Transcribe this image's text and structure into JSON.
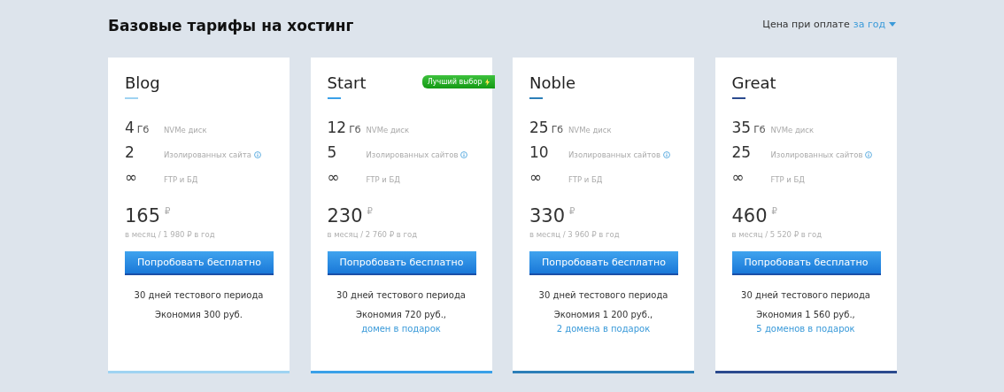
{
  "header": {
    "title": "Базовые тарифы на хостинг",
    "price_label": "Цена при оплате",
    "period_link": "за год"
  },
  "plans": [
    {
      "name": "Blog",
      "color": "#9fd3f2",
      "features": [
        {
          "value": "4",
          "unit": "Гб",
          "label": "NVMe диск",
          "info": false
        },
        {
          "value": "2",
          "label": "Изолированных сайта",
          "info": true
        },
        {
          "value": "∞",
          "label": "FTP и БД",
          "info": false
        }
      ],
      "price": "165",
      "currency": "₽",
      "period": "в месяц / 1 980 ₽ в год",
      "button": "Попробовать бесплатно",
      "trial": "30 дней тестового периода",
      "savings": "Экономия 300 руб."
    },
    {
      "name": "Start",
      "color": "#3aa0e8",
      "badge": "Лучший выбор",
      "features": [
        {
          "value": "12",
          "unit": "Гб",
          "label": "NVMe диск",
          "info": false
        },
        {
          "value": "5",
          "label": "Изолированных сайтов",
          "info": true
        },
        {
          "value": "∞",
          "label": "FTP и БД",
          "info": false
        }
      ],
      "price": "230",
      "currency": "₽",
      "period": "в месяц / 2 760 ₽ в год",
      "button": "Попробовать бесплатно",
      "trial": "30 дней тестового периода",
      "savings": "Экономия 720 руб.,",
      "gift": "домен в подарок"
    },
    {
      "name": "Noble",
      "color": "#2c7fb8",
      "features": [
        {
          "value": "25",
          "unit": "Гб",
          "label": "NVMe диск",
          "info": false
        },
        {
          "value": "10",
          "label": "Изолированных сайтов",
          "info": true
        },
        {
          "value": "∞",
          "label": "FTP и БД",
          "info": false
        }
      ],
      "price": "330",
      "currency": "₽",
      "period": "в месяц / 3 960 ₽ в год",
      "button": "Попробовать бесплатно",
      "trial": "30 дней тестового периода",
      "savings": "Экономия 1 200 руб.,",
      "gift": "2 домена в подарок"
    },
    {
      "name": "Great",
      "color": "#2b4a8e",
      "features": [
        {
          "value": "35",
          "unit": "Гб",
          "label": "NVMe диск",
          "info": false
        },
        {
          "value": "25",
          "label": "Изолированных сайтов",
          "info": true
        },
        {
          "value": "∞",
          "label": "FTP и БД",
          "info": false
        }
      ],
      "price": "460",
      "currency": "₽",
      "period": "в месяц / 5 520 ₽ в год",
      "button": "Попробовать бесплатно",
      "trial": "30 дней тестового периода",
      "savings": "Экономия 1 560 руб.,",
      "gift": "5 доменов в подарок"
    }
  ]
}
